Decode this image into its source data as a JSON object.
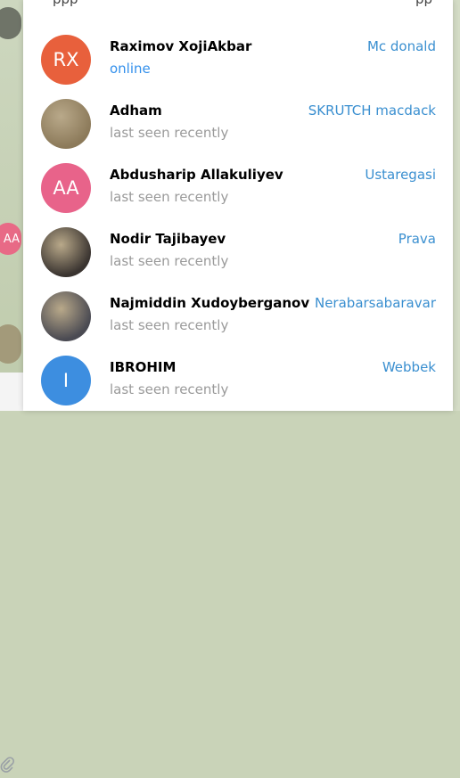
{
  "background": {
    "mid_avatar_initials": "AA"
  },
  "members": [
    {
      "name": "Raximov XojiAkbar",
      "status": "online",
      "online": true,
      "label": "Mc donald",
      "initials": "RX",
      "avatar_color": "#e8603c",
      "avatar_type": "initials"
    },
    {
      "name": "Adham",
      "status": "last seen recently",
      "online": false,
      "label": "SKRUTCH macdack",
      "initials": "",
      "avatar_color": "#8c7a5a",
      "avatar_type": "photo"
    },
    {
      "name": "Abdusharip Allakuliyev",
      "status": "last seen recently",
      "online": false,
      "label": "Ustaregasi",
      "initials": "AA",
      "avatar_color": "#e8638a",
      "avatar_type": "initials"
    },
    {
      "name": "Nodir Tajibayev",
      "status": "last seen recently",
      "online": false,
      "label": "Prava",
      "initials": "",
      "avatar_color": "#3a3430",
      "avatar_type": "photo"
    },
    {
      "name": "Najmiddin Xudoyberganov",
      "status": "last seen recently",
      "online": false,
      "label": "Nerabarsabaravar",
      "initials": "",
      "avatar_color": "#4a4a52",
      "avatar_type": "photo"
    },
    {
      "name": "IBROHIM",
      "status": "last seen recently",
      "online": false,
      "label": "Webbek",
      "initials": "I",
      "avatar_color": "#3d8ee0",
      "avatar_type": "initials"
    }
  ]
}
